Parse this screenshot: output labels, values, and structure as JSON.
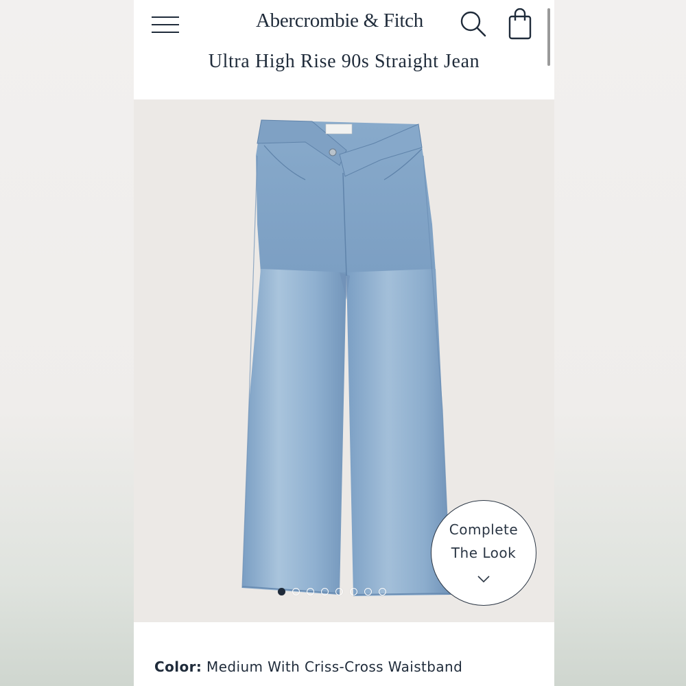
{
  "header": {
    "brand": "Abercrombie & Fitch",
    "product_title": "Ultra High Rise 90s Straight Jean"
  },
  "icons": {
    "menu": "hamburger-menu-icon",
    "search": "search-icon",
    "bag": "shopping-bag-icon",
    "chevron": "chevron-down-icon"
  },
  "gallery": {
    "image_count": 8,
    "active_index": 0
  },
  "complete_look": {
    "line1": "Complete",
    "line2": "The Look"
  },
  "color": {
    "label": "Color:",
    "value": "Medium With Criss-Cross Waistband"
  },
  "colors": {
    "text": "#1f2b3a",
    "image_bg": "#ece9e6",
    "denim": "#8aaecf"
  }
}
